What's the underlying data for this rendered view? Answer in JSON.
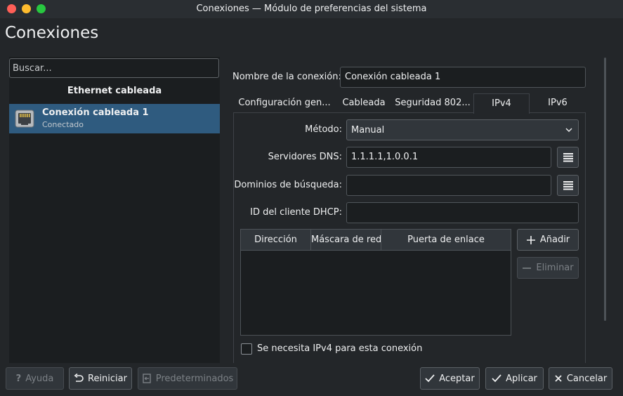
{
  "window": {
    "title": "Conexiones — Módulo de preferencias del sistema",
    "controls": {
      "close_color": "#ff5f57",
      "minimize_color": "#febc2e",
      "zoom_color": "#28c840"
    }
  },
  "page_title": "Conexiones",
  "sidebar": {
    "search_placeholder": "Buscar...",
    "group_heading": "Ethernet cableada",
    "connections": [
      {
        "name": "Conexión cableada 1",
        "status": "Conectado",
        "icon": "ethernet-icon",
        "selected": true
      }
    ]
  },
  "detail": {
    "name_label": "Nombre de la conexión:",
    "name_value": "Conexión cableada 1",
    "tabs": [
      {
        "label": "Configuración gen...",
        "active": false
      },
      {
        "label": "Cableada",
        "active": false
      },
      {
        "label": "Seguridad 802...",
        "active": false
      },
      {
        "label": "IPv4",
        "active": true
      },
      {
        "label": "IPv6",
        "active": false
      }
    ],
    "ipv4": {
      "method_label": "Método:",
      "method_value": "Manual",
      "dns_label": "Servidores DNS:",
      "dns_value": "1.1.1.1,1.0.0.1",
      "search_domains_label": "Dominios de búsqueda:",
      "search_domains_value": "",
      "dhcp_client_id_label": "ID del cliente DHCP:",
      "dhcp_client_id_value": "",
      "table_headers": [
        "Dirección",
        "Máscara de red",
        "Puerta de enlace"
      ],
      "add_label": "Añadir",
      "remove_label": "Eliminar",
      "required_checkbox_label": "Se necesita IPv4 para esta conexión",
      "required_checked": false
    }
  },
  "footer": {
    "help_label": "Ayuda",
    "reset_label": "Reiniciar",
    "defaults_label": "Predeterminados",
    "ok_label": "Aceptar",
    "apply_label": "Aplicar",
    "cancel_label": "Cancelar"
  },
  "colors": {
    "background": "#232629",
    "selection": "#2f5b7f",
    "field": "#1b1e20"
  }
}
